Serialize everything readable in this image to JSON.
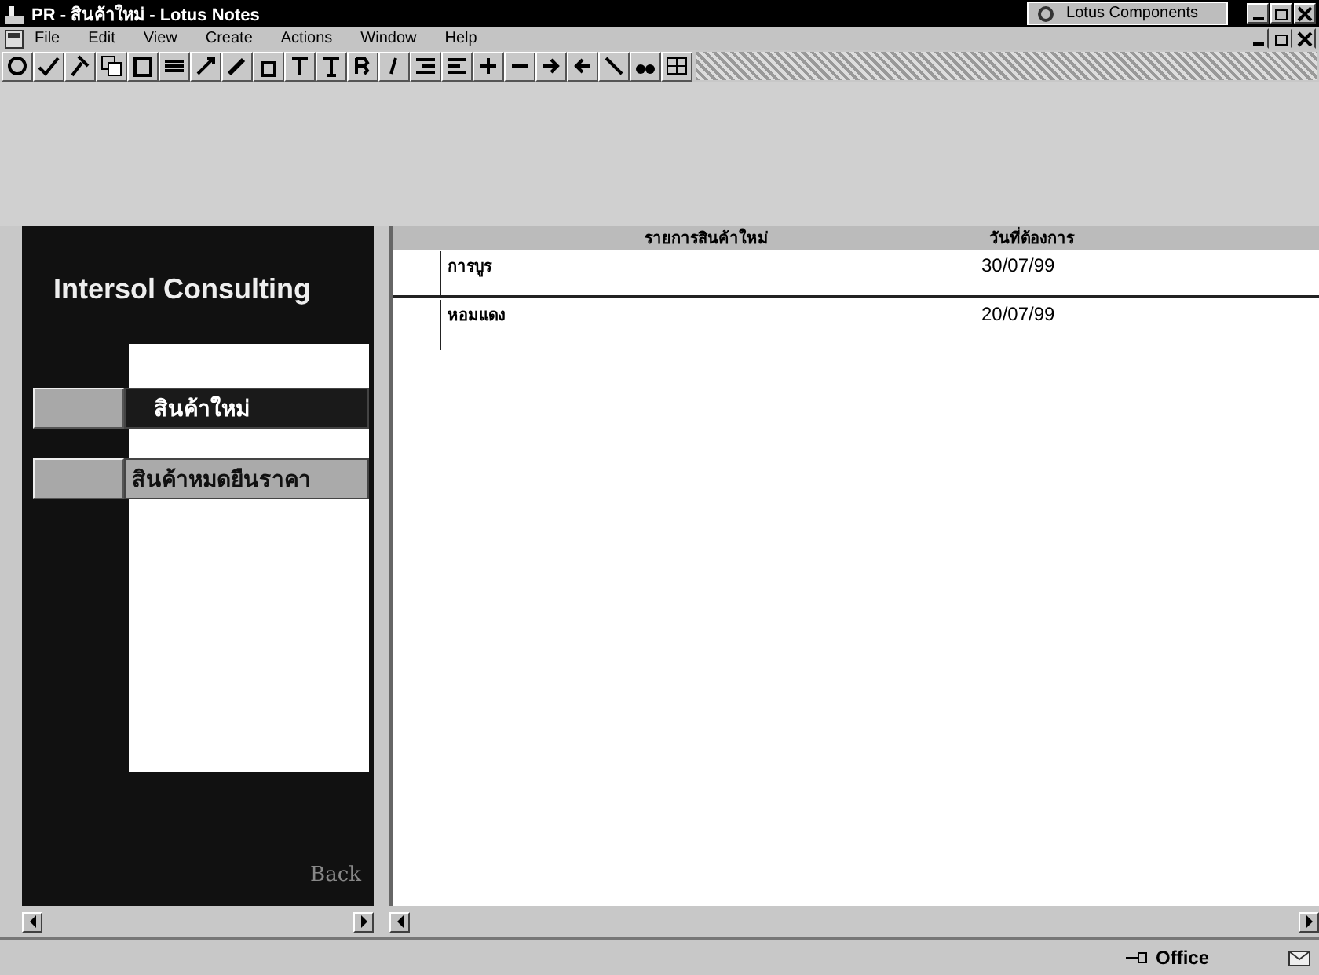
{
  "window": {
    "title": "PR - สินค้าใหม่ - Lotus Notes",
    "taskbar_button": "Lotus Components"
  },
  "menu": [
    "File",
    "Edit",
    "View",
    "Create",
    "Actions",
    "Window",
    "Help"
  ],
  "nav": {
    "brand": "Intersol Consulting",
    "items": [
      {
        "label": "สินค้าใหม่",
        "selected": true
      },
      {
        "label": "สินค้าหมดยืนราคา",
        "selected": false
      }
    ],
    "back": "Back"
  },
  "table": {
    "columns": [
      "รายการสินค้าใหม่",
      "วันที่ต้องการ"
    ],
    "rows": [
      {
        "cells": [
          "การบูร",
          "30/07/99"
        ]
      },
      {
        "cells": [
          "หอมแดง",
          "20/07/99"
        ]
      }
    ]
  },
  "status_bar": {
    "location": "Office"
  }
}
